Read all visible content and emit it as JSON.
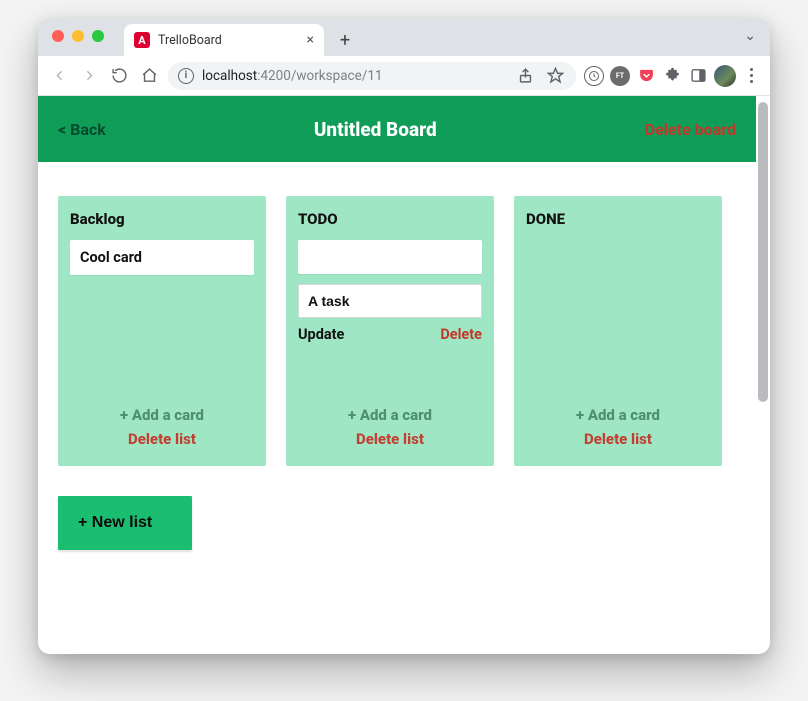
{
  "browser": {
    "tab_title": "TrelloBoard",
    "new_tab_label": "+",
    "tab_close_label": "×",
    "window_dropdown_label": "⌄",
    "url_host": "localhost",
    "url_port_path": ":4200/workspace/11"
  },
  "header": {
    "back_label": "< Back",
    "title": "Untitled Board",
    "delete_board_label": "Delete board"
  },
  "lists": [
    {
      "title": "Backlog",
      "cards": [
        {
          "text": "Cool card",
          "mode": "static"
        }
      ],
      "add_card_label": "+ Add a card",
      "delete_list_label": "Delete list"
    },
    {
      "title": "TODO",
      "cards": [
        {
          "text": "",
          "mode": "blank"
        },
        {
          "text": "A task",
          "mode": "editing",
          "update_label": "Update",
          "delete_label": "Delete"
        }
      ],
      "add_card_label": "+ Add a card",
      "delete_list_label": "Delete list"
    },
    {
      "title": "DONE",
      "cards": [],
      "add_card_label": "+ Add a card",
      "delete_list_label": "Delete list"
    }
  ],
  "new_list_label": "+ New list"
}
